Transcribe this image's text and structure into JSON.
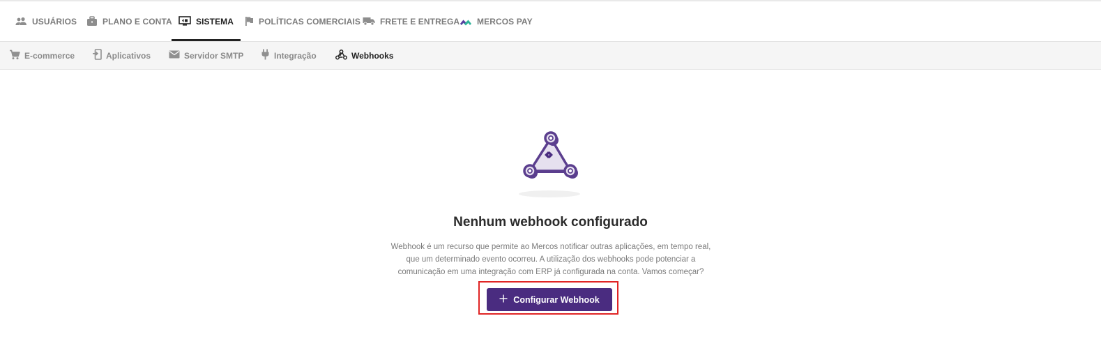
{
  "primary_nav": {
    "items": [
      {
        "label": "USUÁRIOS",
        "icon": "users-icon",
        "active": false
      },
      {
        "label": "PLANO E CONTA",
        "icon": "briefcase-icon",
        "active": false
      },
      {
        "label": "SISTEMA",
        "icon": "system-monitor-icon",
        "active": true
      },
      {
        "label": "POLÍTICAS COMERCIAIS",
        "icon": "flag-icon",
        "active": false
      },
      {
        "label": "FRETE E ENTREGA",
        "icon": "truck-icon",
        "active": false
      },
      {
        "label": "MERCOS PAY",
        "icon": "mercos-pay-logo-icon",
        "active": false
      }
    ]
  },
  "secondary_nav": {
    "items": [
      {
        "label": "E-commerce",
        "icon": "cart-icon",
        "active": false
      },
      {
        "label": "Aplicativos",
        "icon": "app-icon",
        "active": false
      },
      {
        "label": "Servidor SMTP",
        "icon": "mail-icon",
        "active": false
      },
      {
        "label": "Integração",
        "icon": "plug-icon",
        "active": false
      },
      {
        "label": "Webhooks",
        "icon": "webhook-icon",
        "active": true
      }
    ]
  },
  "empty_state": {
    "illustration": "webhook-illustration-icon",
    "title": "Nenhum webhook configurado",
    "description_lines": [
      "Webhook é um recurso que permite ao Mercos notificar outras aplicações, em tempo real,",
      "que um determinado evento ocorreu. A utilização dos webhooks pode potenciar a",
      "comunicação em uma integração com ERP já configurada na conta. Vamos começar?"
    ],
    "cta_label": "Configurar Webhook",
    "cta_icon": "plus-icon"
  },
  "colors": {
    "accent": "#4a2c80",
    "highlight_border": "#e02525",
    "active_text": "#222222",
    "inactive_text": "#7b7b7b"
  }
}
